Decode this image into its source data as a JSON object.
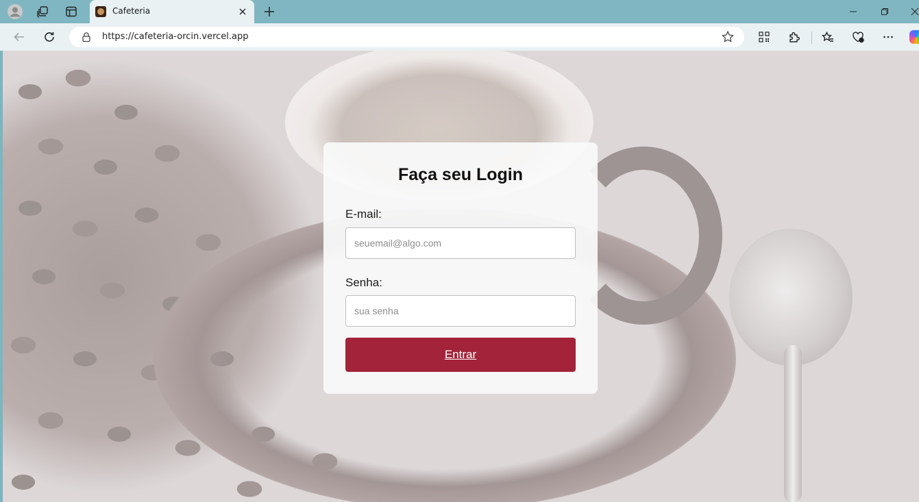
{
  "browser": {
    "tab": {
      "title": "Cafeteria"
    },
    "address_bar": {
      "url": "https://cafeteria-orcin.vercel.app"
    }
  },
  "login": {
    "title": "Faça seu Login",
    "email": {
      "label": "E-mail:",
      "placeholder": "seuemail@algo.com",
      "value": ""
    },
    "password": {
      "label": "Senha:",
      "placeholder": "sua senha",
      "value": ""
    },
    "submit_label": "Entrar"
  },
  "colors": {
    "accent": "#a3233a",
    "browser_frame": "#7fb6c1",
    "toolbar": "#e9f1f3"
  }
}
